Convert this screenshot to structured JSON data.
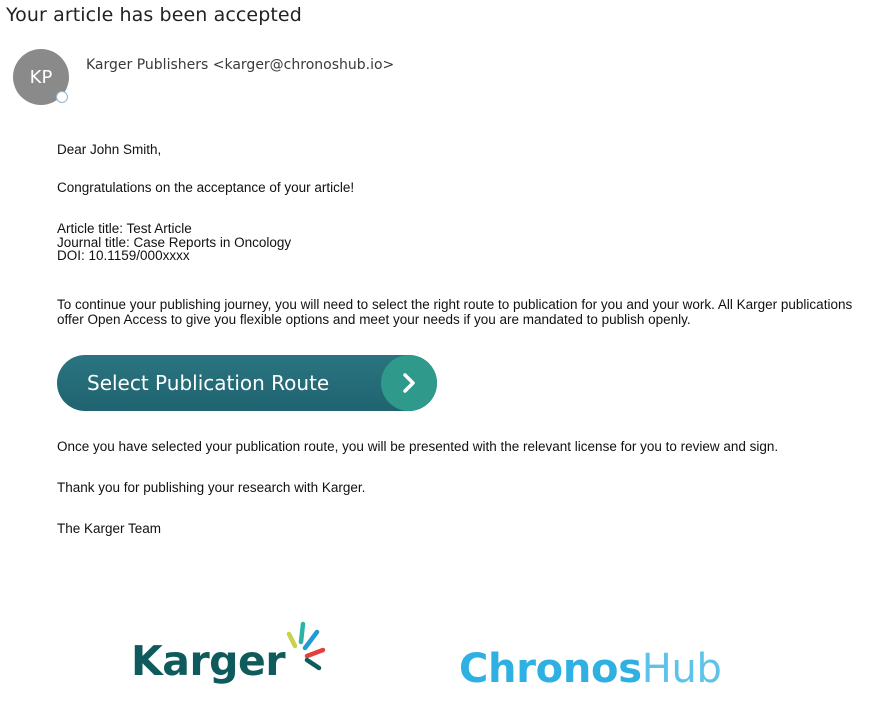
{
  "email": {
    "subject": "Your article has been accepted",
    "avatar_initials": "KP",
    "sender": "Karger Publishers <karger@chronoshub.io>"
  },
  "body": {
    "greeting": "Dear John Smith,",
    "congrats": "Congratulations on the acceptance of your article!",
    "article_title": "Article title: Test Article",
    "journal_title": "Journal title: Case Reports in Oncology",
    "doi": "DOI: 10.1159/000xxxx",
    "journey": "To continue your publishing journey, you will need to select the right route to publication for you and your work. All Karger publications offer Open Access to give you flexible options and meet your needs if you are mandated to publish openly.",
    "cta_label": "Select Publication Route",
    "once_selected": "Once you have selected your publication route, you will be presented with the relevant license for you to review and sign.",
    "thanks": "Thank you for publishing your research with Karger.",
    "signoff": "The Karger Team"
  },
  "footer": {
    "karger_logo_text": "Karger",
    "chronos_strong": "Chronos",
    "chronos_light": "Hub"
  },
  "colors": {
    "button": "#1f6470",
    "button_circle": "#2f9a8c",
    "karger_brand": "#0f5a5c",
    "chronoshub_brand": "#2fb0e3"
  },
  "icons": [
    "presence-icon",
    "chevron-right-icon",
    "karger-logo-mark"
  ]
}
